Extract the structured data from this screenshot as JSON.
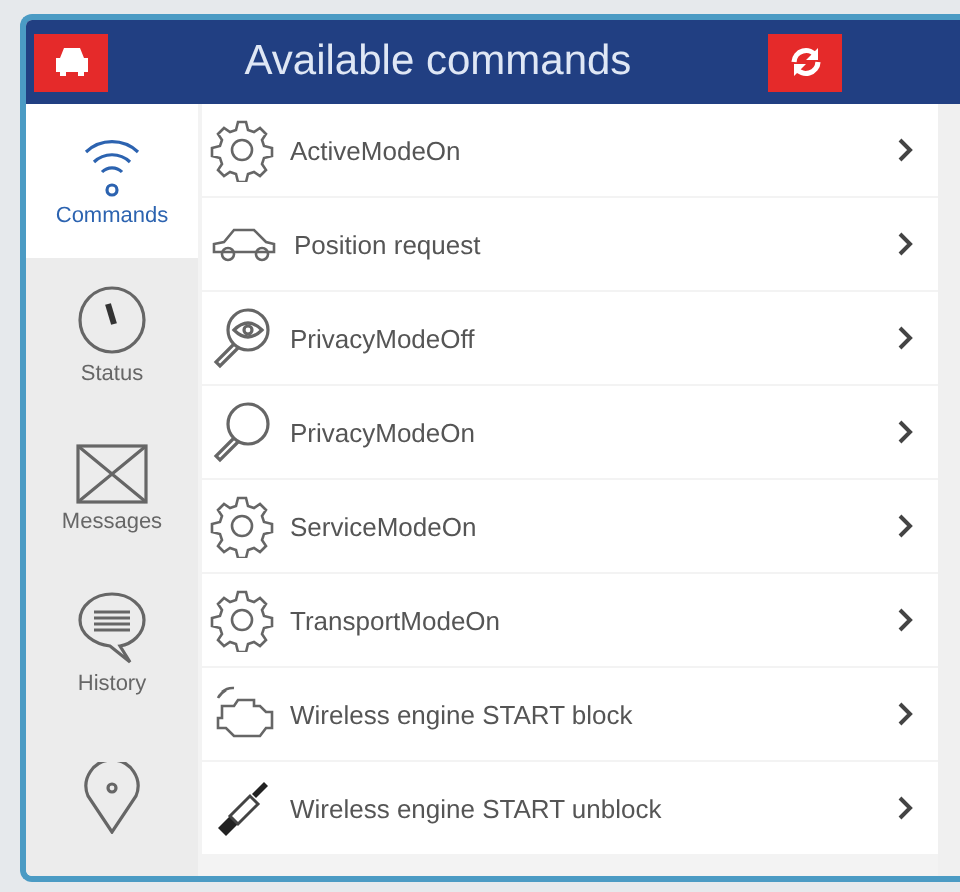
{
  "header": {
    "title": "Available commands"
  },
  "sidebar": {
    "items": [
      {
        "label": "Commands",
        "kind": "wifi",
        "selected": true
      },
      {
        "label": "Status",
        "kind": "gauge",
        "selected": false
      },
      {
        "label": "Messages",
        "kind": "envelope",
        "selected": false
      },
      {
        "label": "History",
        "kind": "speech",
        "selected": false
      },
      {
        "kind": "pin",
        "selected": false
      }
    ]
  },
  "commands": [
    {
      "label": "ActiveModeOn",
      "kind": "gear"
    },
    {
      "label": "Position request",
      "kind": "car"
    },
    {
      "label": "PrivacyModeOff",
      "kind": "eye-magnifier"
    },
    {
      "label": "PrivacyModeOn",
      "kind": "magnifier"
    },
    {
      "label": "ServiceModeOn",
      "kind": "gear"
    },
    {
      "label": "TransportModeOn",
      "kind": "gear"
    },
    {
      "label": "Wireless engine START block",
      "kind": "engine"
    },
    {
      "label": "Wireless engine START unblock",
      "kind": "plug"
    }
  ]
}
